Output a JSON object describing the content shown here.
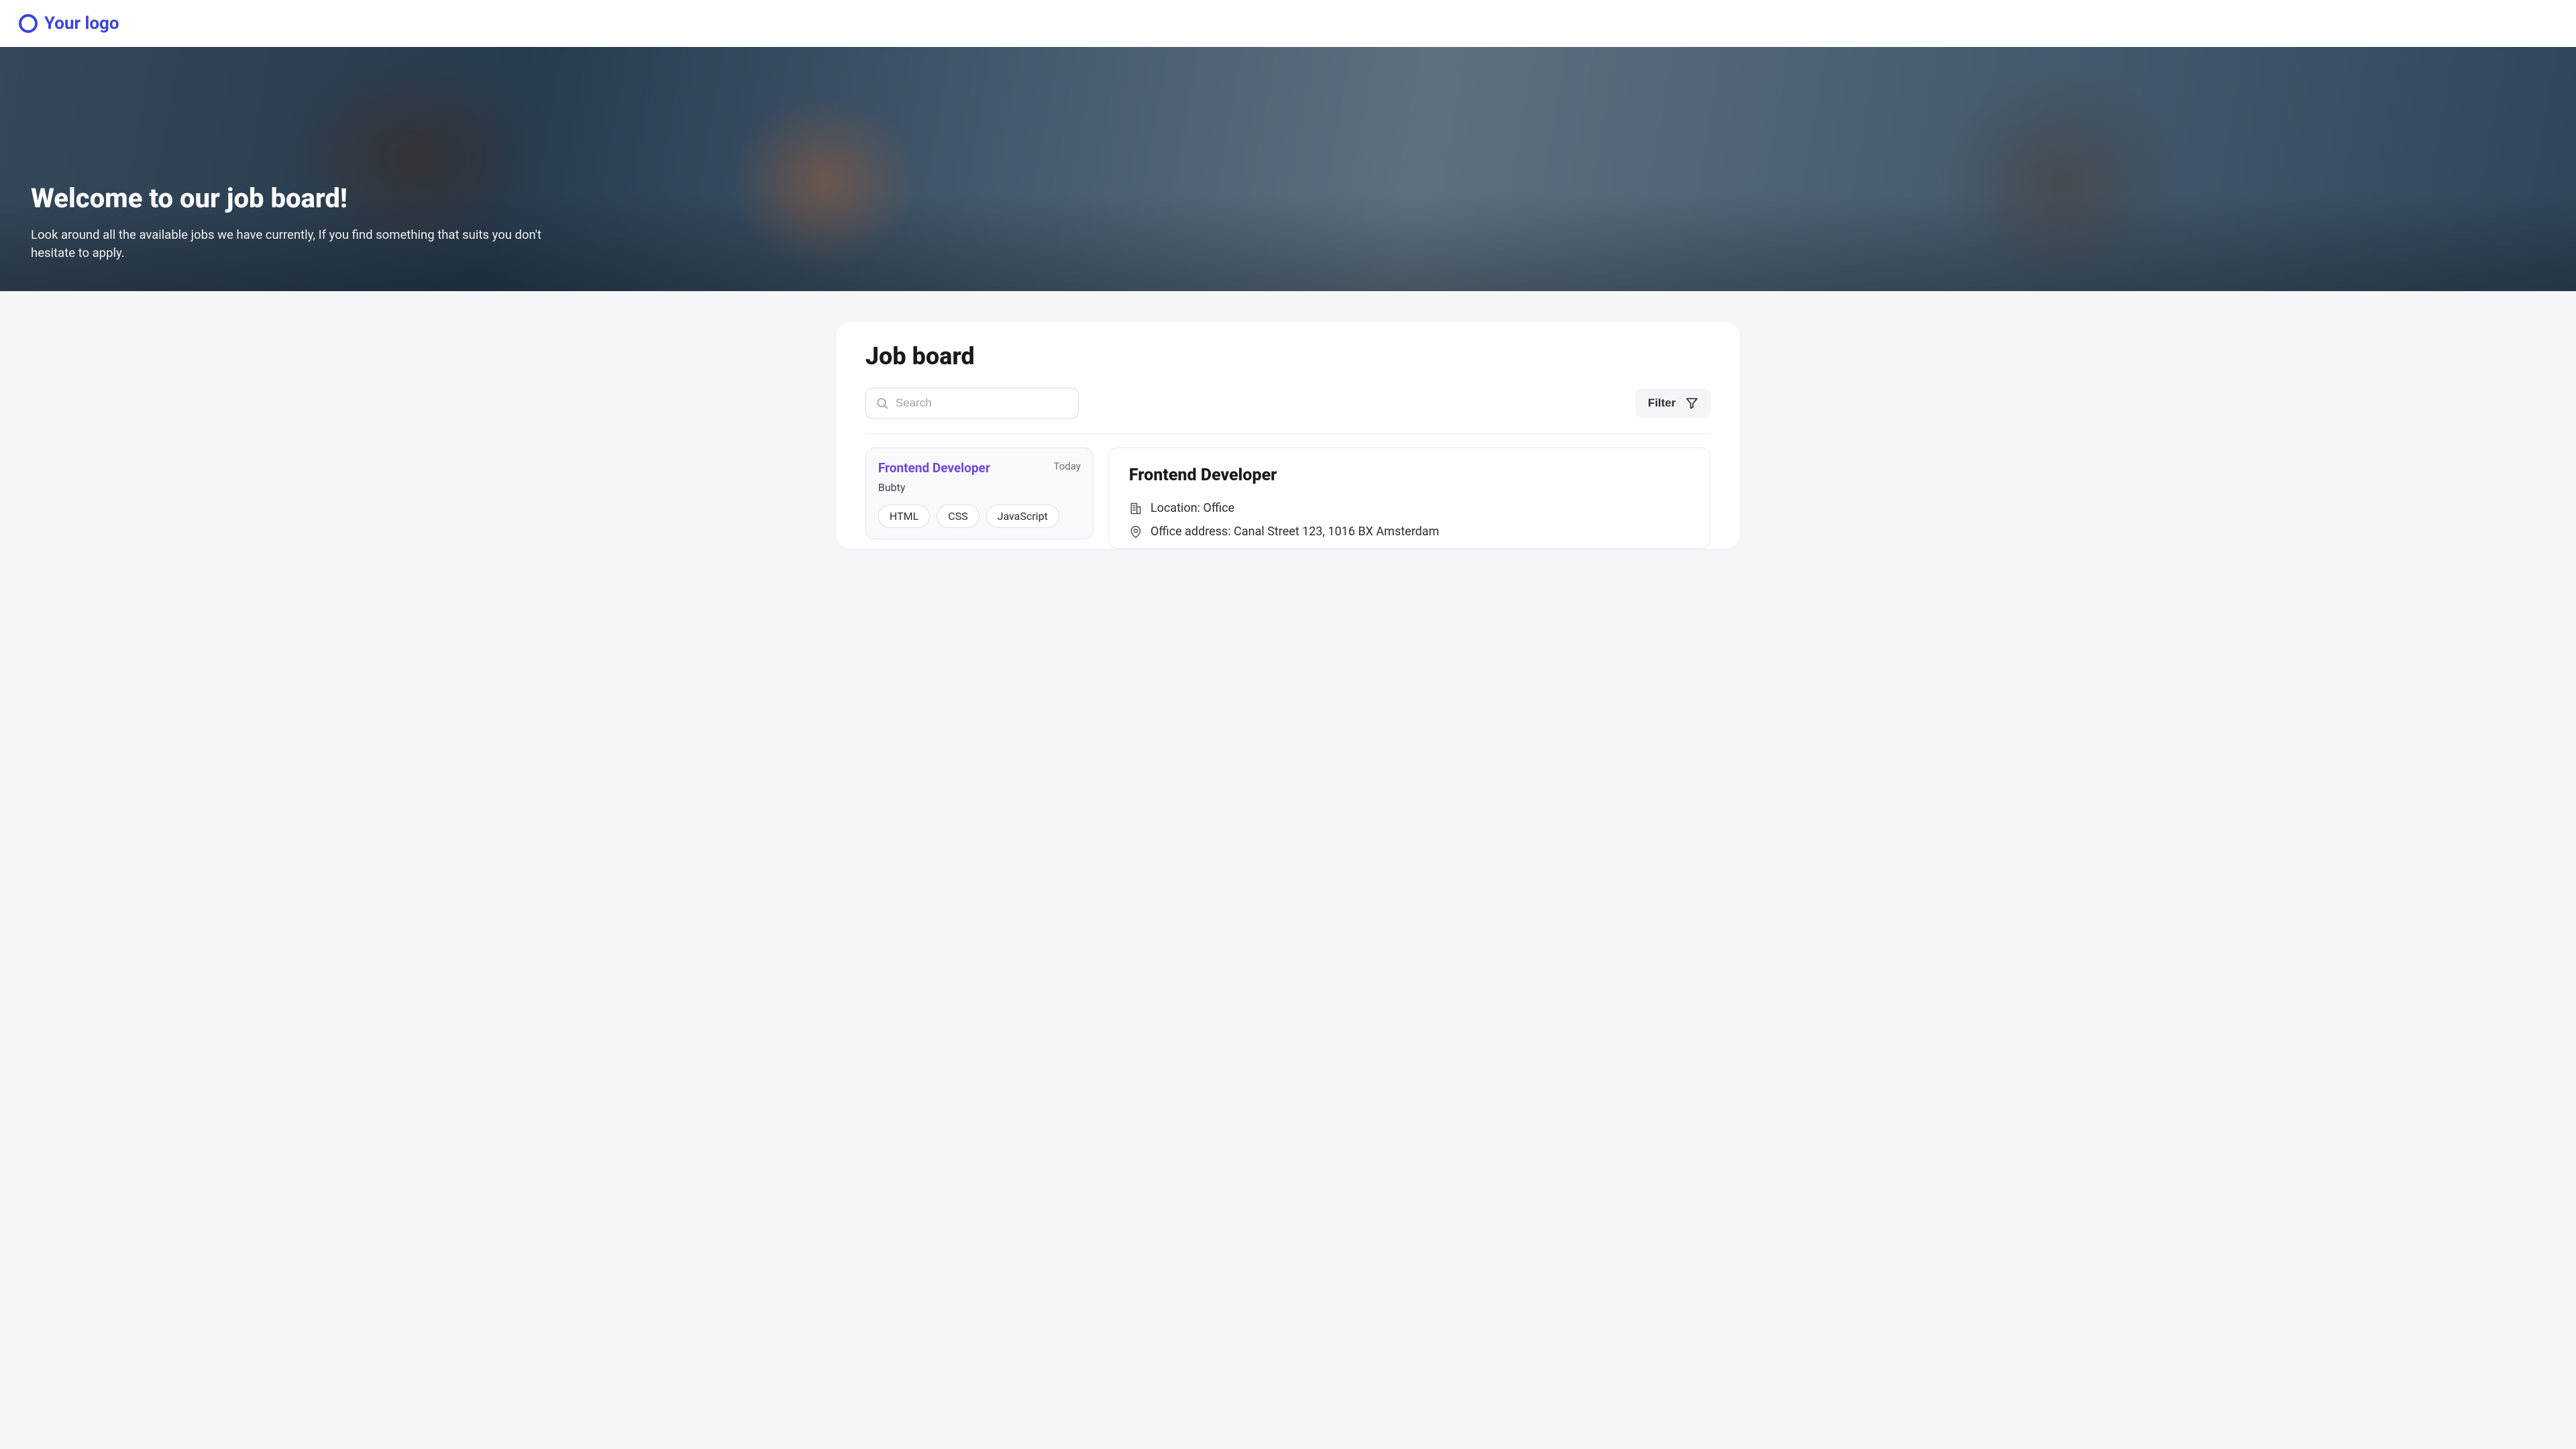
{
  "header": {
    "logo_text": "Your logo"
  },
  "hero": {
    "title": "Welcome to our job board!",
    "subtitle": "Look around all the available jobs we have currently, If you find something that suits you don't hesitate to apply."
  },
  "board": {
    "title": "Job board",
    "search_placeholder": "Search",
    "filter_label": "Filter",
    "jobs": [
      {
        "title": "Frontend Developer",
        "date": "Today",
        "company": "Bubty",
        "tags": [
          "HTML",
          "CSS",
          "JavaScript"
        ]
      }
    ],
    "detail": {
      "title": "Frontend Developer",
      "location": "Location: Office",
      "address": "Office address: Canal Street 123, 1016 BX Amsterdam"
    }
  }
}
